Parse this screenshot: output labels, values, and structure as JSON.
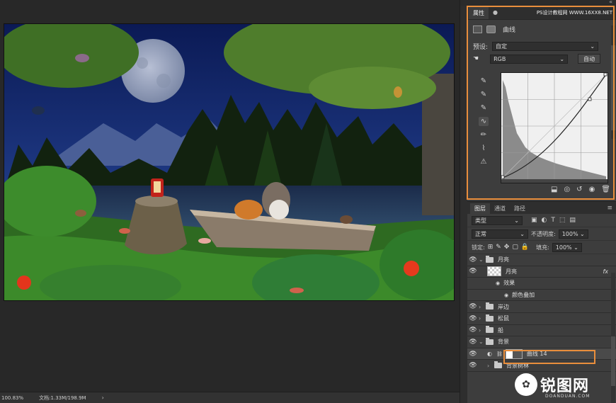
{
  "status": {
    "zoom": "100.83%",
    "doc": "文档:1.33M/198.9M",
    "more": "›"
  },
  "properties": {
    "tabs": [
      "属性",
      "●"
    ],
    "watermark": "PS设计教程网 WWW.16XX8.NET",
    "adjustment_name": "曲线",
    "preset_label": "预设:",
    "preset_value": "自定",
    "channel_value": "RGB",
    "auto_label": "自动"
  },
  "layers_panel": {
    "tabs": [
      "图层",
      "通道",
      "路径"
    ],
    "filter_kind": "类型",
    "blend_mode": "正常",
    "opacity_label": "不透明度:",
    "opacity_value": "100%",
    "lock_label": "锁定:",
    "fill_label": "填充:",
    "fill_value": "100%",
    "rows": [
      {
        "name": "月亮",
        "kind": "group",
        "expanded": true,
        "indent": 0
      },
      {
        "name": "月亮",
        "kind": "layer",
        "fx": "fx",
        "indent": 1
      },
      {
        "name": "效果",
        "kind": "effect",
        "indent": 2
      },
      {
        "name": "颜色叠加",
        "kind": "effect",
        "indent": 3
      },
      {
        "name": "岸边",
        "kind": "group",
        "expanded": false,
        "indent": 0
      },
      {
        "name": "松鼠",
        "kind": "group",
        "expanded": false,
        "indent": 0
      },
      {
        "name": "船",
        "kind": "group",
        "expanded": false,
        "indent": 0
      },
      {
        "name": "背景",
        "kind": "group",
        "expanded": true,
        "indent": 0
      },
      {
        "name": "曲线 14",
        "kind": "adjustment",
        "indent": 1
      },
      {
        "name": "背景树林",
        "kind": "group",
        "expanded": false,
        "indent": 1
      }
    ]
  },
  "logo": {
    "mark": "✿",
    "text": "锐图网",
    "sub": "DOANDUAN.COM"
  },
  "colors": {
    "highlight": "#e98e3c",
    "panel": "#3d3d3d",
    "canvas_bg": "#282828"
  }
}
